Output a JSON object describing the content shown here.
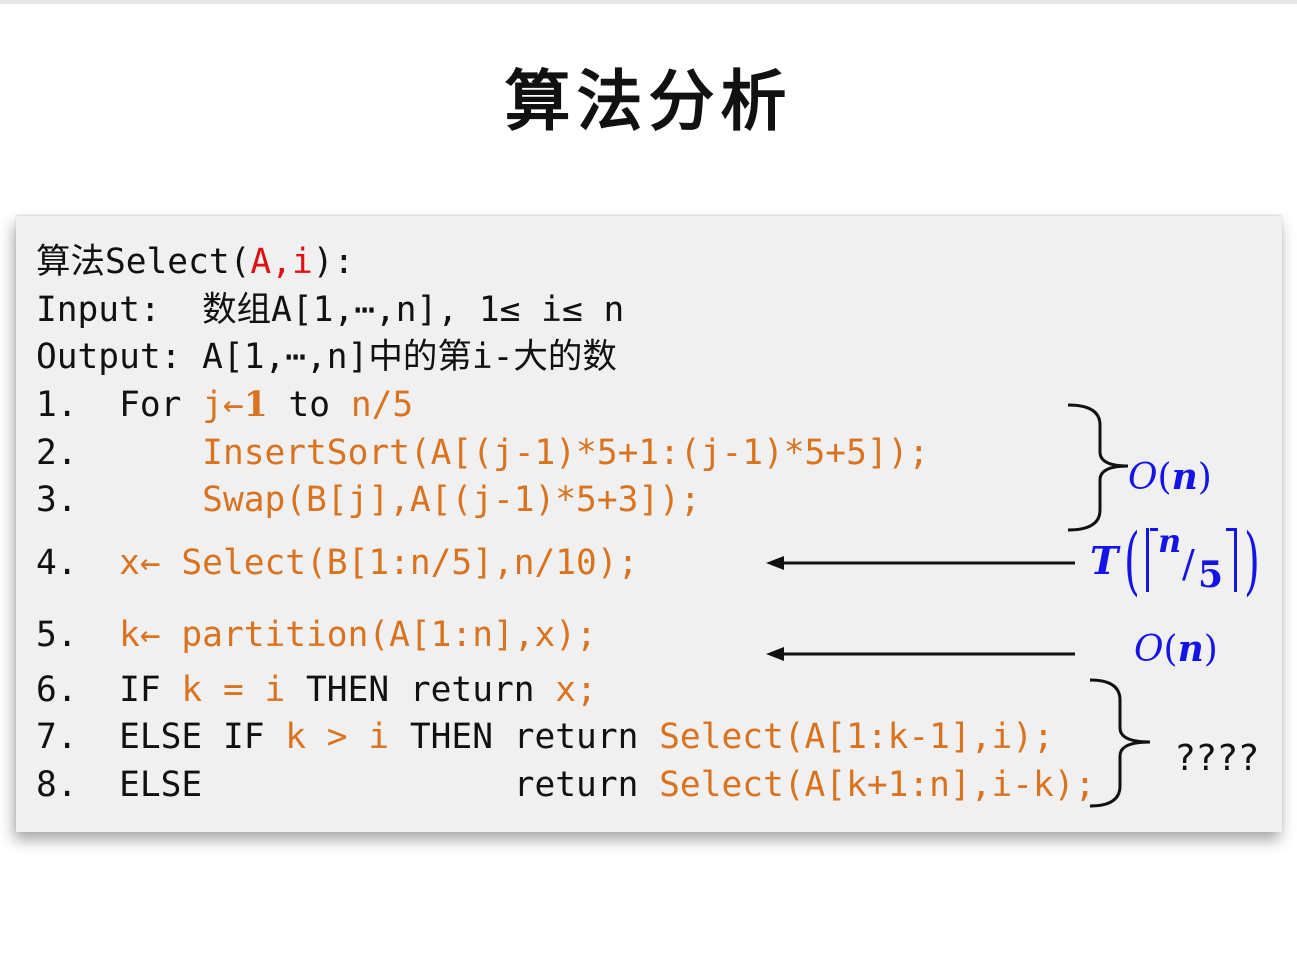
{
  "title": "算法分析",
  "algorithm": {
    "header": {
      "prefix": "算法Select(",
      "param_a": "A",
      "comma": ",",
      "param_i": "i",
      "suffix": "):"
    },
    "input": "Input:  数组A[1,⋯,n], 1≤ i≤ n",
    "output": "Output: A[1,⋯,n]中的第i-大的数",
    "lines": [
      {
        "num": "1.",
        "pre": "For ",
        "var": "j",
        "arrow": "←",
        "bold": "1",
        "mid": " to ",
        "tail": "n/5"
      },
      {
        "num": "2.",
        "code": "InsertSort(A[(j-1)*5+1:(j-1)*5+5]);"
      },
      {
        "num": "3.",
        "code": "Swap(B[j],A[(j-1)*5+3]);"
      },
      {
        "num": "4.",
        "code": "x← Select(B[1:n/5],n/10);"
      },
      {
        "num": "5.",
        "code": "k← partition(A[1:n],x);"
      },
      {
        "num": "6.",
        "kw1": "IF ",
        "cond": "k = i",
        "kw2": " THEN return ",
        "ret": "x;"
      },
      {
        "num": "7.",
        "kw1": "ELSE IF ",
        "cond": "k > i",
        "kw2": " THEN return ",
        "ret": "Select(A[1:k-1],i);"
      },
      {
        "num": "8.",
        "kw1": "ELSE",
        "kw2": "return ",
        "ret": "Select(A[k+1:n],i-k);"
      }
    ]
  },
  "annotations": {
    "on_loop": {
      "O": "O",
      "lp": "(",
      "n": "n",
      "rp": ")"
    },
    "recursive": {
      "T": "T",
      "num": "n",
      "slash": "/",
      "den": "5"
    },
    "on_partition": {
      "O": "O",
      "lp": "(",
      "n": "n",
      "rp": ")"
    },
    "unknown": "????"
  },
  "colors": {
    "orange": "#d9731f",
    "red": "#e01010",
    "blue": "#1414e6"
  }
}
